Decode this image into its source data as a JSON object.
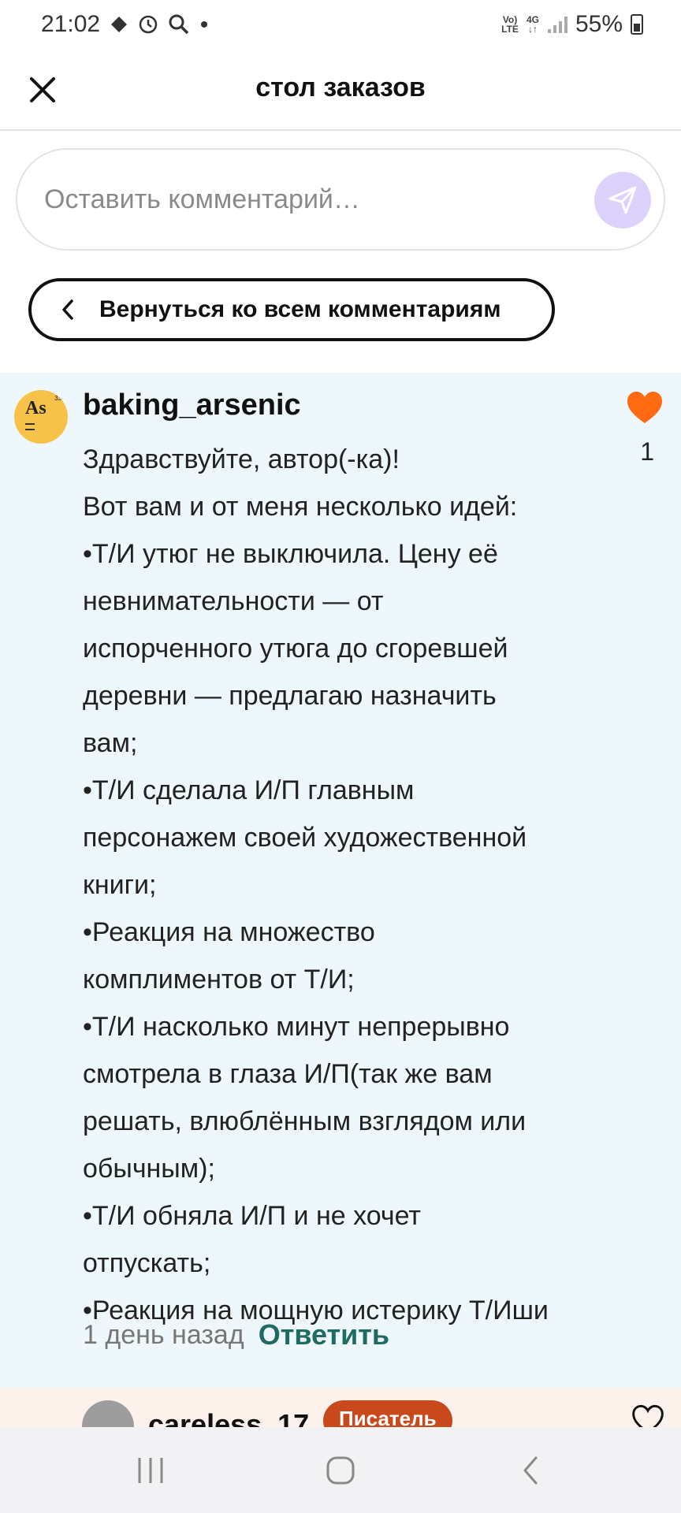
{
  "status_bar": {
    "time": "21:02",
    "network_top": "Vo)",
    "network_bottom": "LTE",
    "net_type": "4G",
    "battery": "55%"
  },
  "header": {
    "title": "стол заказов"
  },
  "comment_input": {
    "placeholder": "Оставить комментарий…"
  },
  "back_button": {
    "label": "Вернуться ко всем комментариям"
  },
  "comment": {
    "avatar_text": "As",
    "avatar_number": "33",
    "username": "baking_arsenic",
    "likes": "1",
    "lines": [
      "Здравствуйте, автор(-ка)!",
      "Вот вам и от меня несколько идей:",
      "•Т/И утюг не выключила. Цену её",
      "невнимательности — от",
      "испорченного утюга до сгоревшей",
      "деревни — предлагаю назначить",
      "вам;",
      "•Т/И сделала И/П главным",
      "персонажем своей художественной",
      "книги;",
      "•Реакция на множество",
      "комплиментов от Т/И;",
      "•Т/И насколько минут непрерывно",
      "смотрела в глаза И/П(так же вам",
      "решать, влюблённым взглядом или",
      "обычным);",
      "•Т/И обняла И/П и не хочет",
      "отпускать;",
      "•Реакция на мощную истерику Т/Иши"
    ],
    "time_ago": "1 день назад",
    "reply_label": "Ответить"
  },
  "next_comment": {
    "username": "careless_17",
    "badge": "Писатель"
  },
  "colors": {
    "accent_like": "#ff6a13",
    "reply": "#1e6b63",
    "send_bg": "#ddd2fb",
    "card_bg": "#eef7fb",
    "badge_bg": "#c84a1c"
  }
}
